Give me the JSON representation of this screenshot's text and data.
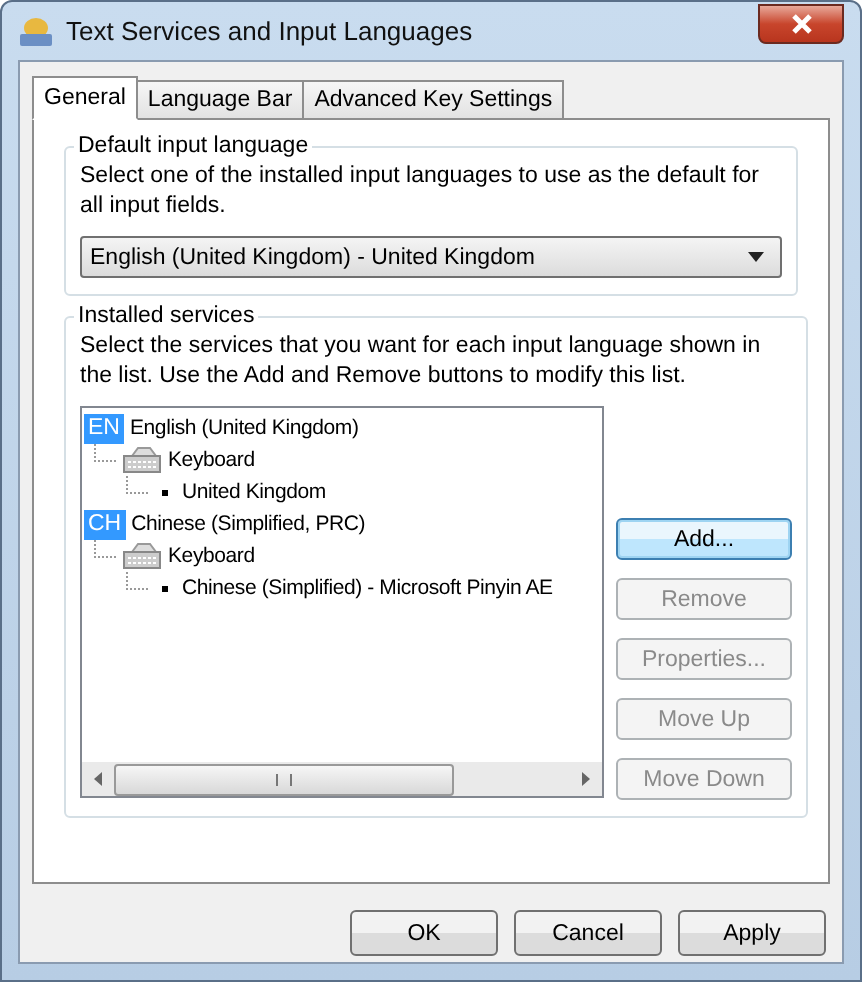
{
  "window": {
    "title": "Text Services and Input Languages"
  },
  "tabs": [
    {
      "label": "General",
      "selected": true
    },
    {
      "label": "Language Bar",
      "selected": false
    },
    {
      "label": "Advanced Key Settings",
      "selected": false
    }
  ],
  "default_input_language": {
    "title": "Default input language",
    "description": "Select one of the installed input languages to use as the default for all input fields.",
    "dropdown": {
      "value": "English (United Kingdom) - United Kingdom"
    }
  },
  "installed_services": {
    "title": "Installed services",
    "description": "Select the services that you want for each input language shown in the list. Use the Add and Remove buttons to modify this list.",
    "tree": [
      {
        "kind": "language",
        "badge": "EN",
        "label": "English (United Kingdom)",
        "children": [
          {
            "kind": "keyboard",
            "label": "Keyboard",
            "children": [
              {
                "kind": "layout",
                "label": "United Kingdom"
              }
            ]
          }
        ]
      },
      {
        "kind": "language",
        "badge": "CH",
        "label": "Chinese (Simplified, PRC)",
        "children": [
          {
            "kind": "keyboard",
            "label": "Keyboard",
            "children": [
              {
                "kind": "layout",
                "label": "Chinese (Simplified) - Microsoft Pinyin AE"
              }
            ]
          }
        ]
      }
    ],
    "buttons": [
      {
        "label": "Add...",
        "disabled": false,
        "default": true
      },
      {
        "label": "Remove",
        "disabled": true,
        "default": false
      },
      {
        "label": "Properties...",
        "disabled": true,
        "default": false
      },
      {
        "label": "Move Up",
        "disabled": true,
        "default": false
      },
      {
        "label": "Move Down",
        "disabled": true,
        "default": false
      }
    ]
  },
  "buttons": [
    {
      "label": "OK",
      "disabled": false
    },
    {
      "label": "Cancel",
      "disabled": false
    },
    {
      "label": "Apply",
      "disabled": false
    }
  ]
}
